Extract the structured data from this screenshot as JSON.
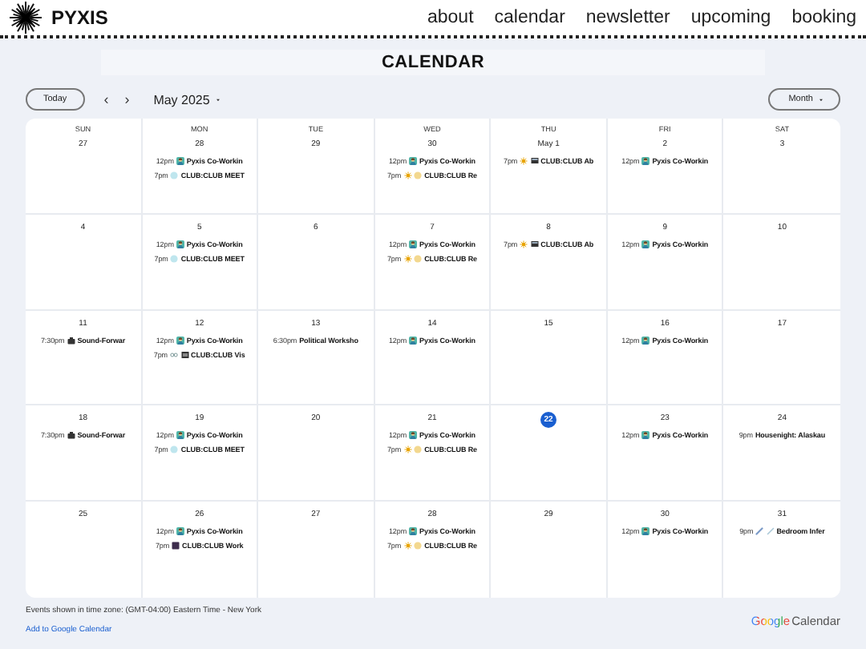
{
  "site": {
    "name": "PYXIS",
    "nav": [
      "about",
      "calendar",
      "newsletter",
      "upcoming",
      "booking"
    ]
  },
  "title": "CALENDAR",
  "toolbar": {
    "today": "Today",
    "prev": "‹",
    "next": "›",
    "month": "May 2025",
    "view": "Month"
  },
  "weekdays": [
    "SUN",
    "MON",
    "TUE",
    "WED",
    "THU",
    "FRI",
    "SAT"
  ],
  "weeks": [
    {
      "days": [
        {
          "date": "27",
          "today": false
        },
        {
          "date": "28",
          "today": false,
          "events": [
            {
              "time": "12pm",
              "title": "Pyxis Co-Workin",
              "kind": "coworking"
            },
            {
              "time": "7pm",
              "title": "CLUB:CLUB MEET",
              "kind": "club-meet"
            }
          ]
        },
        {
          "date": "29",
          "today": false
        },
        {
          "date": "30",
          "today": false,
          "events": [
            {
              "time": "12pm",
              "title": "Pyxis Co-Workin",
              "kind": "coworking"
            },
            {
              "time": "7pm",
              "title": "CLUB:CLUB Re",
              "kind": "club-re"
            }
          ]
        },
        {
          "date": "May 1",
          "today": false,
          "events": [
            {
              "time": "7pm",
              "title": "CLUB:CLUB Ab",
              "kind": "club-ab"
            }
          ]
        },
        {
          "date": "2",
          "today": false,
          "events": [
            {
              "time": "12pm",
              "title": "Pyxis Co-Workin",
              "kind": "coworking"
            }
          ]
        },
        {
          "date": "3",
          "today": false
        }
      ]
    },
    {
      "days": [
        {
          "date": "4",
          "today": false
        },
        {
          "date": "5",
          "today": false,
          "events": [
            {
              "time": "12pm",
              "title": "Pyxis Co-Workin",
              "kind": "coworking"
            },
            {
              "time": "7pm",
              "title": "CLUB:CLUB MEET",
              "kind": "club-meet"
            }
          ]
        },
        {
          "date": "6",
          "today": false
        },
        {
          "date": "7",
          "today": false,
          "events": [
            {
              "time": "12pm",
              "title": "Pyxis Co-Workin",
              "kind": "coworking"
            },
            {
              "time": "7pm",
              "title": "CLUB:CLUB Re",
              "kind": "club-re"
            }
          ]
        },
        {
          "date": "8",
          "today": false,
          "events": [
            {
              "time": "7pm",
              "title": "CLUB:CLUB Ab",
              "kind": "club-ab"
            }
          ]
        },
        {
          "date": "9",
          "today": false,
          "events": [
            {
              "time": "12pm",
              "title": "Pyxis Co-Workin",
              "kind": "coworking"
            }
          ]
        },
        {
          "date": "10",
          "today": false
        }
      ]
    },
    {
      "days": [
        {
          "date": "11",
          "today": false,
          "events": [
            {
              "time": "7:30pm",
              "title": "Sound-Forwar",
              "kind": "sound"
            }
          ]
        },
        {
          "date": "12",
          "today": false,
          "events": [
            {
              "time": "12pm",
              "title": "Pyxis Co-Workin",
              "kind": "coworking"
            },
            {
              "time": "7pm",
              "title": "CLUB:CLUB Vis",
              "kind": "club-vis"
            }
          ]
        },
        {
          "date": "13",
          "today": false,
          "events": [
            {
              "time": "6:30pm",
              "title": "Political Worksho",
              "kind": "plain"
            }
          ]
        },
        {
          "date": "14",
          "today": false,
          "events": [
            {
              "time": "12pm",
              "title": "Pyxis Co-Workin",
              "kind": "coworking"
            }
          ]
        },
        {
          "date": "15",
          "today": false
        },
        {
          "date": "16",
          "today": false,
          "events": [
            {
              "time": "12pm",
              "title": "Pyxis Co-Workin",
              "kind": "coworking"
            }
          ]
        },
        {
          "date": "17",
          "today": false
        }
      ]
    },
    {
      "days": [
        {
          "date": "18",
          "today": false,
          "events": [
            {
              "time": "7:30pm",
              "title": "Sound-Forwar",
              "kind": "sound"
            }
          ]
        },
        {
          "date": "19",
          "today": false,
          "events": [
            {
              "time": "12pm",
              "title": "Pyxis Co-Workin",
              "kind": "coworking"
            },
            {
              "time": "7pm",
              "title": "CLUB:CLUB MEET",
              "kind": "club-meet"
            }
          ]
        },
        {
          "date": "20",
          "today": false
        },
        {
          "date": "21",
          "today": false,
          "events": [
            {
              "time": "12pm",
              "title": "Pyxis Co-Workin",
              "kind": "coworking"
            },
            {
              "time": "7pm",
              "title": "CLUB:CLUB Re",
              "kind": "club-re"
            }
          ]
        },
        {
          "date": "22",
          "today": true
        },
        {
          "date": "23",
          "today": false,
          "events": [
            {
              "time": "12pm",
              "title": "Pyxis Co-Workin",
              "kind": "coworking"
            }
          ]
        },
        {
          "date": "24",
          "today": false,
          "events": [
            {
              "time": "9pm",
              "title": "Housenight: Alaskau",
              "kind": "plain"
            }
          ]
        }
      ]
    },
    {
      "days": [
        {
          "date": "25",
          "today": false
        },
        {
          "date": "26",
          "today": false,
          "events": [
            {
              "time": "12pm",
              "title": "Pyxis Co-Workin",
              "kind": "coworking"
            },
            {
              "time": "7pm",
              "title": "CLUB:CLUB Work",
              "kind": "club-work"
            }
          ]
        },
        {
          "date": "27",
          "today": false
        },
        {
          "date": "28",
          "today": false,
          "events": [
            {
              "time": "12pm",
              "title": "Pyxis Co-Workin",
              "kind": "coworking"
            },
            {
              "time": "7pm",
              "title": "CLUB:CLUB Re",
              "kind": "club-re"
            }
          ]
        },
        {
          "date": "29",
          "today": false
        },
        {
          "date": "30",
          "today": false,
          "events": [
            {
              "time": "12pm",
              "title": "Pyxis Co-Workin",
              "kind": "coworking"
            }
          ]
        },
        {
          "date": "31",
          "today": false,
          "events": [
            {
              "time": "9pm",
              "title": "Bedroom Infer",
              "kind": "links"
            }
          ]
        }
      ]
    }
  ],
  "footer": {
    "timezone": "Events shown in time zone: (GMT-04:00) Eastern Time - New York",
    "link": "Add to Google Calendar",
    "brand": "Google",
    "brand_product": "Calendar"
  }
}
